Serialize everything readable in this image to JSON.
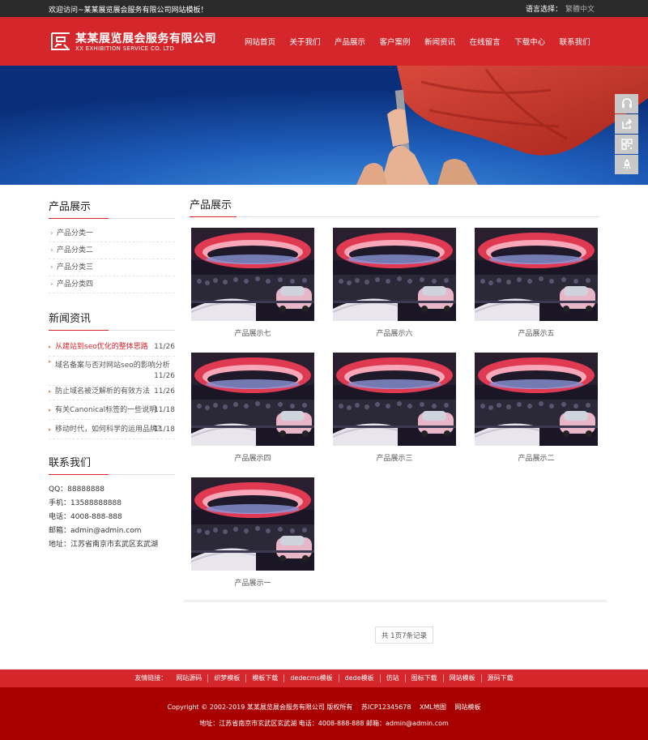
{
  "topbar": {
    "welcome": "欢迎访问~某某展览展会服务有限公司网站模板！",
    "lang_label": "语言选择：",
    "lang_option": "繁體中文"
  },
  "header": {
    "title": "某某展览展会服务有限公司",
    "subtitle": "XX EXHIBITION SERVICE CO. LTD",
    "nav": [
      "网站首页",
      "关于我们",
      "产品展示",
      "客户案例",
      "新闻资讯",
      "在线留言",
      "下载中心",
      "联系我们"
    ]
  },
  "side_tools": [
    "headset-icon",
    "share-icon",
    "qrcode-icon",
    "rocket-icon"
  ],
  "sidebar": {
    "products_title": "产品展示",
    "categories": [
      "产品分类一",
      "产品分类二",
      "产品分类三",
      "产品分类四"
    ],
    "news_title": "新闻资讯",
    "news": [
      {
        "title": "从建站到seo优化的整体思路",
        "date": "11/26"
      },
      {
        "title": "域名备案与否对网站seo的影响分析",
        "date": "11/26"
      },
      {
        "title": "防止域名被泛解析的有效方法",
        "date": "11/26"
      },
      {
        "title": "有关Canonical标签的一些说明",
        "date": "11/18"
      },
      {
        "title": "移动时代，如何科学的运用品牌？",
        "date": "11/18"
      }
    ],
    "contact_title": "联系我们",
    "contact": [
      "QQ：88888888",
      "手机：13588888888",
      "电话：4008-888-888",
      "邮箱：admin@admin.com",
      "地址：江苏省南京市玄武区玄武湖"
    ]
  },
  "main": {
    "title": "产品展示",
    "products": [
      "产品展示七",
      "产品展示六",
      "产品展示五",
      "产品展示四",
      "产品展示三",
      "产品展示二",
      "产品展示一"
    ],
    "pager": "共 1页7条记录"
  },
  "footer": {
    "links_label": "友情链接：",
    "links": [
      "网站源码",
      "织梦模板",
      "模板下载",
      "dedecms模板",
      "dede模板",
      "仿站",
      "图标下载",
      "网站模板",
      "源码下载"
    ],
    "copyright": "Copyright © 2002-2019 某某展览展会服务有限公司 版权所有",
    "icp": "苏ICP12345678",
    "sitemap": "XML地图",
    "template": "网站模板",
    "address_line": "地址：江苏省南京市玄武区玄武湖 电话：4008-888-888 邮箱：admin@admin.com"
  },
  "colors": {
    "brand_red": "#d5262c",
    "footer_dark": "#a80000",
    "topbar": "#2b2b2b"
  }
}
